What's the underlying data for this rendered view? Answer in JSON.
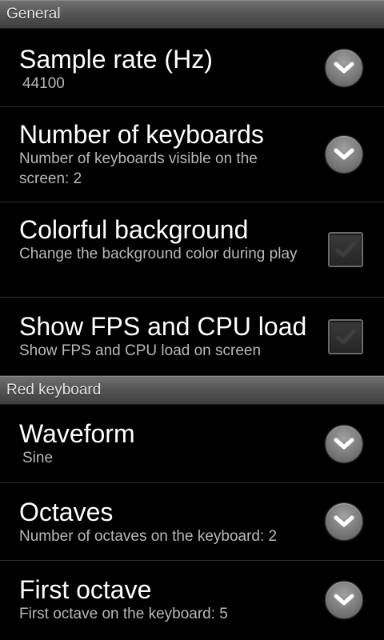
{
  "colors": {
    "background": "#000000",
    "header_gradient_top": "#6f6f6f",
    "header_gradient_bottom": "#3e3e3e",
    "summary_text": "#b8b8b8",
    "divider": "#2e2e2e"
  },
  "sections": [
    {
      "header": "General",
      "items": [
        {
          "title": "Sample rate (Hz)",
          "summary": "44100",
          "control": "chevron-down-icon"
        },
        {
          "title": "Number of keyboards",
          "summary": "Number of keyboards visible on the screen: 2",
          "control": "chevron-down-icon"
        },
        {
          "title": "Colorful background",
          "summary": "Change the background color during play",
          "control": "checkbox",
          "checked": false
        },
        {
          "title": "Show FPS and CPU load",
          "summary": "Show FPS and CPU load on screen",
          "control": "checkbox",
          "checked": false
        }
      ]
    },
    {
      "header": "Red keyboard",
      "items": [
        {
          "title": "Waveform",
          "summary": "Sine",
          "control": "chevron-down-icon"
        },
        {
          "title": "Octaves",
          "summary": "Number of octaves on the keyboard: 2",
          "control": "chevron-down-icon"
        },
        {
          "title": "First octave",
          "summary": "First octave on the keyboard: 5",
          "control": "chevron-down-icon"
        }
      ]
    }
  ]
}
